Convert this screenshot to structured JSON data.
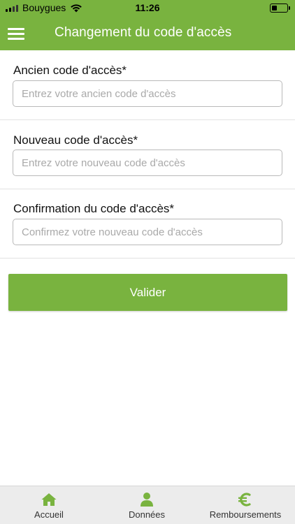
{
  "status_bar": {
    "carrier": "Bouygues",
    "time": "11:26"
  },
  "header": {
    "title": "Changement du code d'accès",
    "menu_icon": "hamburger-menu-icon"
  },
  "form": {
    "old_code": {
      "label": "Ancien code d'accès*",
      "placeholder": "Entrez votre ancien code d'accès",
      "value": ""
    },
    "new_code": {
      "label": "Nouveau code d'accès*",
      "placeholder": "Entrez votre nouveau code d'accès",
      "value": ""
    },
    "confirm_code": {
      "label": "Confirmation du code d'accès*",
      "placeholder": "Confirmez votre nouveau code d'accès",
      "value": ""
    },
    "submit_label": "Valider"
  },
  "tabbar": {
    "items": [
      {
        "label": "Accueil",
        "icon": "home-icon"
      },
      {
        "label": "Données",
        "icon": "person-icon"
      },
      {
        "label": "Remboursements",
        "icon": "euro-icon"
      }
    ]
  },
  "colors": {
    "accent": "#79b33f",
    "tab_icon": "#79b33f",
    "tabbar_bg": "#ececec"
  }
}
